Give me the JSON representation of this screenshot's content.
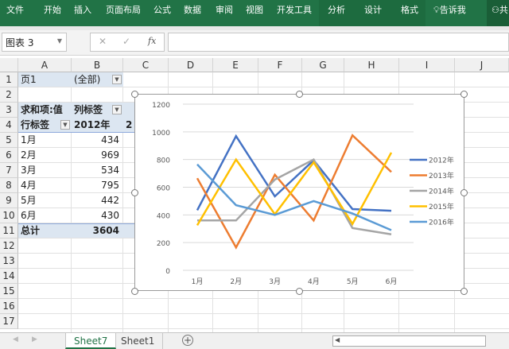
{
  "ribbon": {
    "tabs": [
      "文件",
      "开始",
      "插入",
      "页面布局",
      "公式",
      "数据",
      "审阅",
      "视图",
      "开发工具",
      "分析",
      "设计",
      "格式"
    ],
    "tell_me": "告诉我",
    "share": "共"
  },
  "formula_bar": {
    "name_box": "图表 3",
    "cancel": "✕",
    "enter": "✓",
    "fx": "fx",
    "value": ""
  },
  "columns": [
    "A",
    "B",
    "C",
    "D",
    "E",
    "F",
    "G",
    "H",
    "I",
    "J"
  ],
  "rows": [
    "1",
    "2",
    "3",
    "4",
    "5",
    "6",
    "7",
    "8",
    "9",
    "10",
    "11",
    "12",
    "13",
    "14",
    "15",
    "16",
    "17"
  ],
  "pivot": {
    "filter_label": "页1",
    "filter_value": "(全部)",
    "values_label": "求和项:值",
    "col_labels": "列标签",
    "row_labels": "行标签",
    "col_header": "2012年",
    "col_header_next": "2",
    "rows": [
      {
        "label": "1月",
        "value": "434"
      },
      {
        "label": "2月",
        "value": "969"
      },
      {
        "label": "3月",
        "value": "534"
      },
      {
        "label": "4月",
        "value": "795"
      },
      {
        "label": "5月",
        "value": "442"
      },
      {
        "label": "6月",
        "value": "430"
      }
    ],
    "total_label": "总计",
    "total_value": "3604"
  },
  "chart_data": {
    "type": "line",
    "categories": [
      "1月",
      "2月",
      "3月",
      "4月",
      "5月",
      "6月"
    ],
    "ylim": [
      0,
      1200
    ],
    "yticks": [
      "0",
      "200",
      "400",
      "600",
      "800",
      "1000",
      "1200"
    ],
    "grid": true,
    "legend": "right",
    "series": [
      {
        "name": "2012年",
        "color": "#4472c4",
        "values": [
          434,
          969,
          534,
          795,
          442,
          430
        ]
      },
      {
        "name": "2013年",
        "color": "#ed7d31",
        "values": [
          665,
          165,
          690,
          360,
          975,
          710
        ]
      },
      {
        "name": "2014年",
        "color": "#a5a5a5",
        "values": [
          360,
          360,
          655,
          800,
          305,
          260
        ]
      },
      {
        "name": "2015年",
        "color": "#ffc000",
        "values": [
          325,
          800,
          405,
          780,
          335,
          850
        ]
      },
      {
        "name": "2016年",
        "color": "#5b9bd5",
        "values": [
          765,
          470,
          400,
          500,
          410,
          290
        ]
      }
    ]
  },
  "sheets": {
    "tabs": [
      "Sheet7",
      "Sheet1"
    ],
    "active": "Sheet7",
    "add": "+"
  },
  "colors": {
    "ribbon": "#217346",
    "pivot_header": "#dce6f1"
  }
}
